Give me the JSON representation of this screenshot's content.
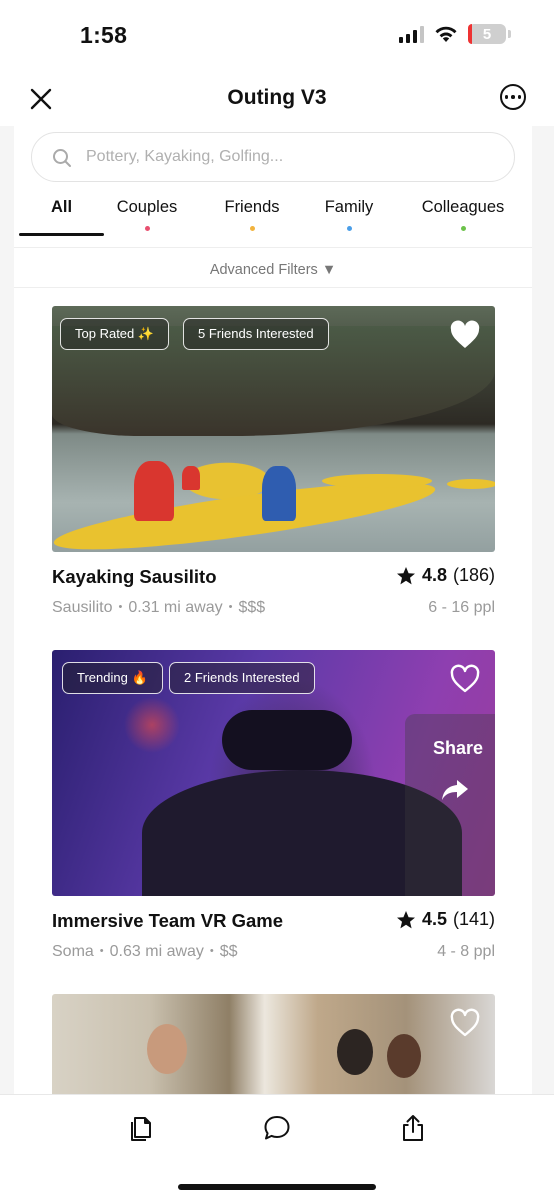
{
  "status_bar": {
    "time": "1:58",
    "battery_level": "5"
  },
  "header": {
    "title": "Outing V3"
  },
  "search": {
    "placeholder": "Pottery, Kayaking, Golfing..."
  },
  "tabs": [
    {
      "label": "All",
      "active": true,
      "dot_color": ""
    },
    {
      "label": "Couples",
      "dot_color": "#e84f6f"
    },
    {
      "label": "Friends",
      "dot_color": "#f2b33d"
    },
    {
      "label": "Family",
      "dot_color": "#4a9ee8"
    },
    {
      "label": "Colleagues",
      "dot_color": "#6cc24a"
    }
  ],
  "advanced_filters": "Advanced Filters ▼",
  "cards": [
    {
      "badges": [
        "Top Rated ✨",
        "5 Friends Interested"
      ],
      "title": "Kayaking Sausilito",
      "rating": "4.8",
      "reviews": "(186)",
      "location": "Sausilito",
      "distance": "0.31 mi away",
      "price": "$$$",
      "group_size": "6 - 16 ppl",
      "favorited": true
    },
    {
      "badges": [
        "Trending 🔥",
        "2 Friends Interested"
      ],
      "title": "Immersive Team VR Game",
      "rating": "4.5",
      "reviews": "(141)",
      "location": "Soma",
      "distance": "0.63 mi away",
      "price": "$$",
      "group_size": "4 - 8 ppl",
      "favorited": false,
      "share_label": "Share"
    },
    {
      "favorited": false
    }
  ],
  "icons": {
    "close": "close-icon",
    "more": "more-options-icon",
    "search": "search-icon",
    "heart": "heart-icon",
    "star": "star-icon",
    "share": "share-arrow-icon",
    "nav": [
      "copy-icon",
      "chat-bubble-icon",
      "share-upload-icon"
    ]
  },
  "colors": {
    "accent": "#111111",
    "muted_text": "#9a9a9a"
  }
}
